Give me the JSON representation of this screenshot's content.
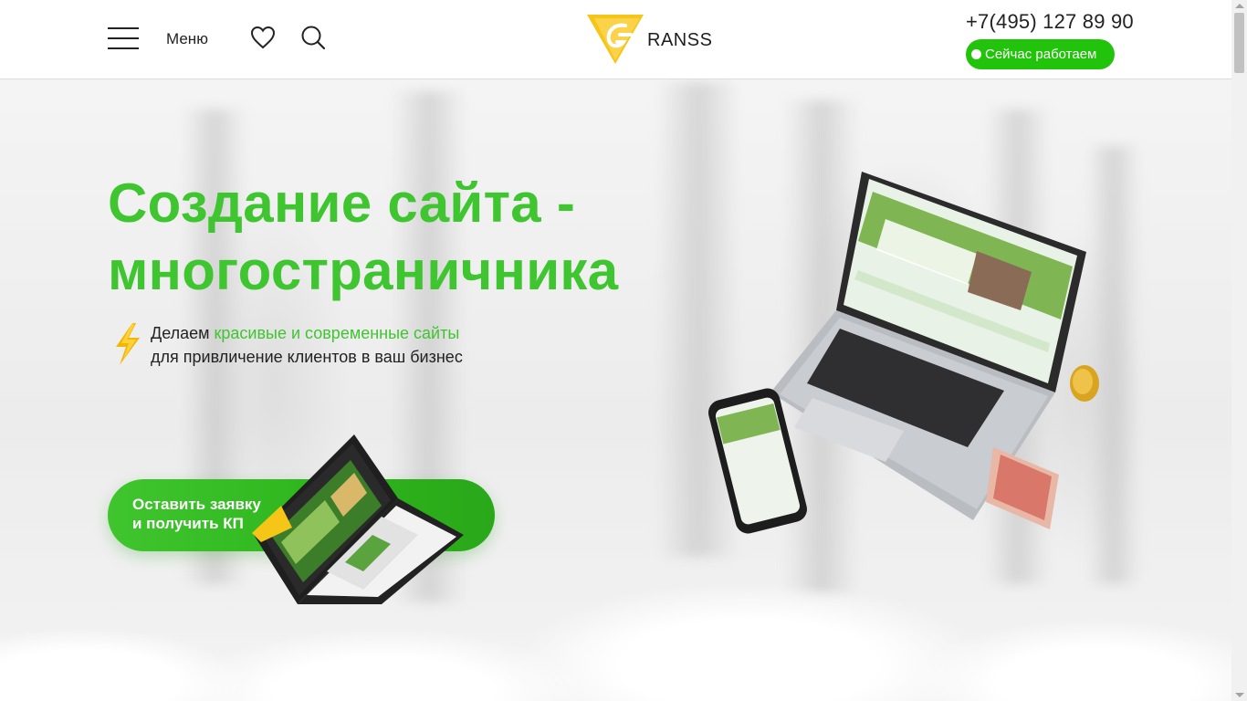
{
  "header": {
    "menu_label": "Меню",
    "logo_text": "RANSS",
    "phone": "+7(495) 127 89 90",
    "status_label": "Сейчас работаем"
  },
  "hero": {
    "title_line1": "Создание сайта -",
    "title_line2": "многостраничника",
    "sub_prefix": "Делаем ",
    "sub_highlight": "красивые и современные сайты",
    "sub_line2": "для привличение клиентов в ваш бизнес",
    "cta_line1": "Оставить заявку",
    "cta_line2": "и получить КП"
  },
  "icons": {
    "menu": "hamburger-icon",
    "favorites": "heart-icon",
    "search": "search-icon",
    "accent": "lightning-icon"
  },
  "colors": {
    "accent_green": "#3fc52f",
    "status_green": "#22c40b",
    "logo_yellow": "#f5c518"
  }
}
